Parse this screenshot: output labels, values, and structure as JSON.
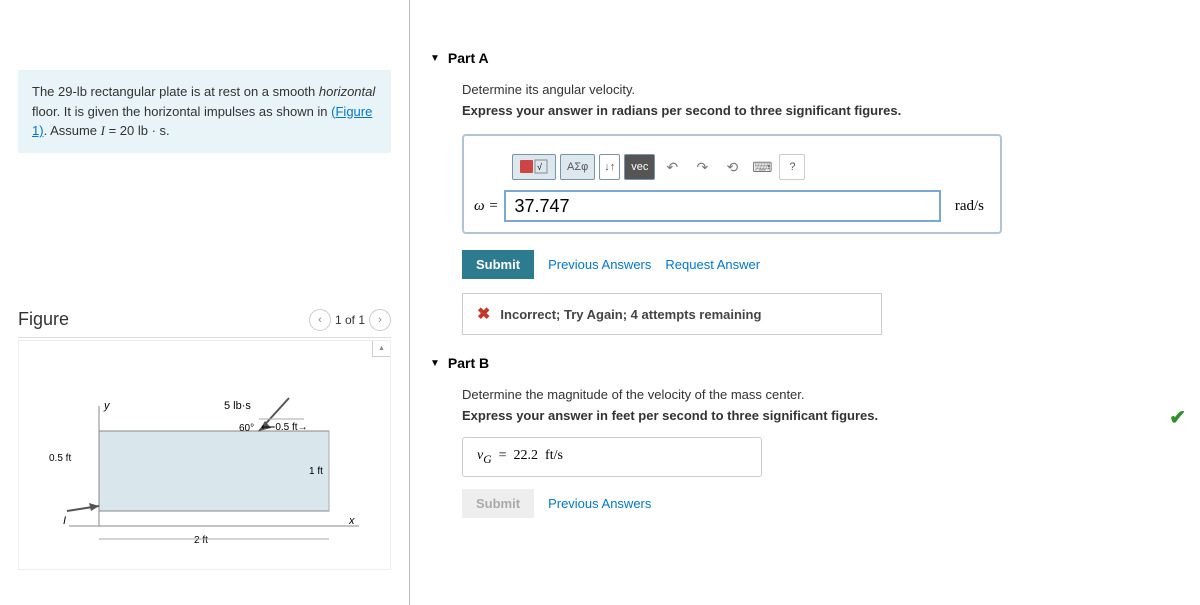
{
  "problem": {
    "text_before_link": "The 29-lb rectangular plate is at rest on a smooth ",
    "italic_word": "horizontal",
    "text_after_italic": " floor. It is given the horizontal impulses as shown in ",
    "figure_link": "(Figure 1)",
    "text_after_link": ". Assume ",
    "impulse_var": "I",
    "impulse_val": " = 20 lb · s."
  },
  "figure": {
    "title": "Figure",
    "nav_text": "1 of 1",
    "labels": {
      "impulse": "5 lb·s",
      "angle": "60°",
      "half_ft": "0.5 ft",
      "half_ft_left": "0.5 ft",
      "one_ft": "1 ft",
      "two_ft": "2 ft",
      "axis_y": "y",
      "axis_x": "x",
      "impulse_I": "I"
    }
  },
  "partA": {
    "title": "Part A",
    "line1": "Determine its angular velocity.",
    "line2": "Express your answer in radians per second to three significant figures.",
    "toolbar": {
      "templates": "√x",
      "greek": "ΑΣφ",
      "vec": "vec",
      "help": "?"
    },
    "var": "ω =",
    "value": "37.747",
    "unit": "rad/s",
    "submit": "Submit",
    "prev": "Previous Answers",
    "req": "Request Answer",
    "feedback": "Incorrect; Try Again; 4 attempts remaining"
  },
  "partB": {
    "title": "Part B",
    "line1": "Determine the magnitude of the velocity of the mass center.",
    "line2": "Express your answer in feet per second to three significant figures.",
    "answer": "vG  =  22.2  ft/s",
    "submit": "Submit",
    "prev": "Previous Answers"
  }
}
